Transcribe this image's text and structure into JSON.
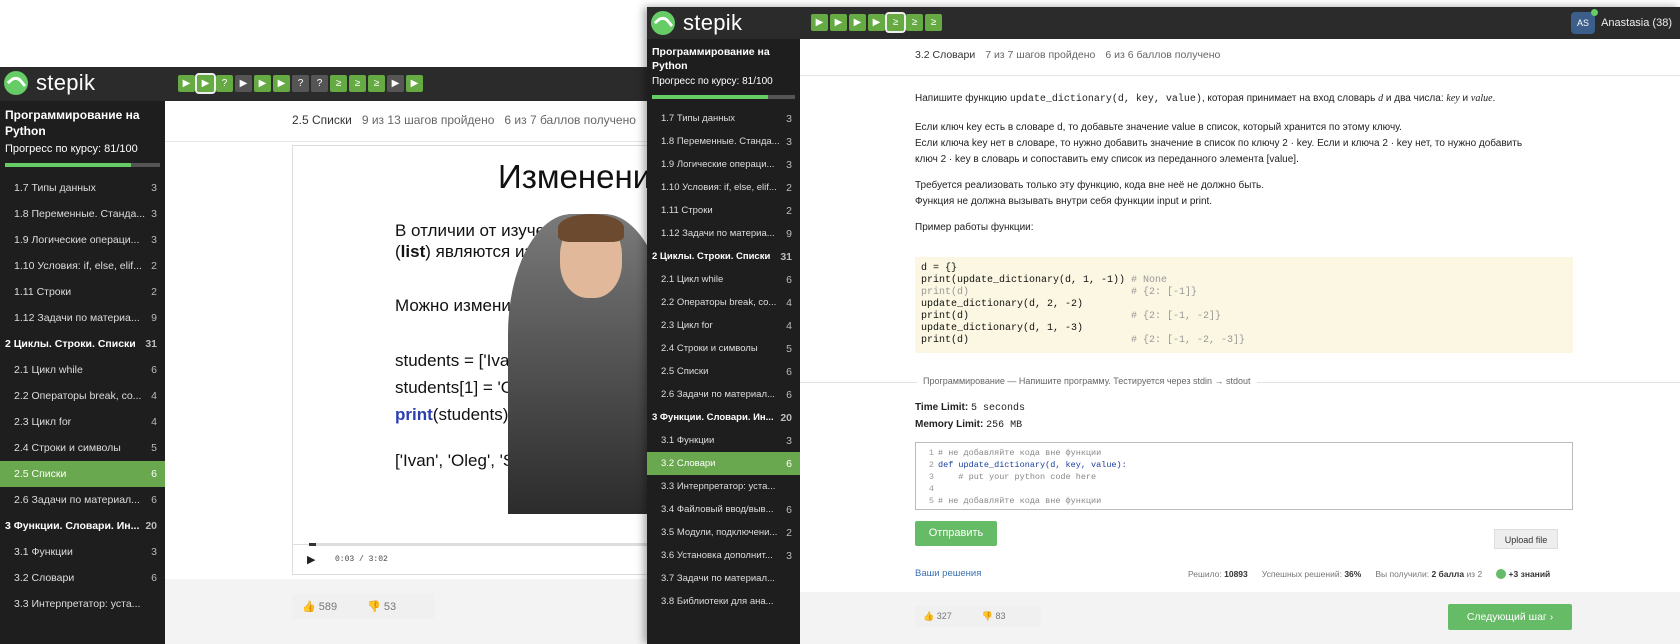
{
  "w1": {
    "logo": "stepik",
    "steps": [
      {
        "icon": "▶",
        "kind": "video"
      },
      {
        "icon": "▶",
        "kind": "video"
      },
      {
        "icon": "?",
        "kind": "quiz"
      },
      {
        "icon": "▶",
        "kind": "video"
      },
      {
        "icon": "▶",
        "kind": "video"
      },
      {
        "icon": "▶",
        "kind": "video"
      },
      {
        "icon": "?",
        "kind": "quiz"
      },
      {
        "icon": "?",
        "kind": "quiz"
      },
      {
        "icon": "≥",
        "kind": "code"
      },
      {
        "icon": "≥",
        "kind": "code"
      },
      {
        "icon": "≥",
        "kind": "code"
      },
      {
        "icon": "▶",
        "kind": "video"
      },
      {
        "icon": "▶",
        "kind": "video"
      }
    ],
    "course": {
      "title": "Программирование на Python",
      "progress_label": "Прогресс по курсу:",
      "progress_value": "81/100",
      "progress_fraction": 0.81
    },
    "items": [
      {
        "label": "1.7 Типы данных",
        "n": "3",
        "type": "item"
      },
      {
        "label": "1.8 Переменные. Станда...",
        "n": "3",
        "type": "item"
      },
      {
        "label": "1.9 Логические операци...",
        "n": "3",
        "type": "item"
      },
      {
        "label": "1.10 Условия: if, else, elif...",
        "n": "2",
        "type": "item"
      },
      {
        "label": "1.11 Строки",
        "n": "2",
        "type": "item"
      },
      {
        "label": "1.12 Задачи по материа...",
        "n": "9",
        "type": "item"
      },
      {
        "label": "2 Циклы. Строки. Списки",
        "n": "31",
        "type": "sec"
      },
      {
        "label": "2.1 Цикл while",
        "n": "6",
        "type": "item"
      },
      {
        "label": "2.2 Операторы break, co...",
        "n": "4",
        "type": "item"
      },
      {
        "label": "2.3 Цикл for",
        "n": "4",
        "type": "item"
      },
      {
        "label": "2.4 Строки и символы",
        "n": "5",
        "type": "item"
      },
      {
        "label": "2.5 Списки",
        "n": "6",
        "type": "active"
      },
      {
        "label": "2.6 Задачи по материал...",
        "n": "6",
        "type": "item"
      },
      {
        "label": "3 Функции. Словари. Ин...",
        "n": "20",
        "type": "sec"
      },
      {
        "label": "3.1 Функции",
        "n": "3",
        "type": "item"
      },
      {
        "label": "3.2 Словари",
        "n": "6",
        "type": "item"
      },
      {
        "label": "3.3 Интерпретатор: уста...",
        "n": "",
        "type": "item"
      }
    ],
    "header": {
      "lesson": "2.5 Списки",
      "steps_done": "9 из 13 шагов пройдено",
      "points": "6 из 7 баллов получено"
    },
    "slide": {
      "title": "Изменени",
      "p1a": "В отличии от изученн",
      "p1b_bold": "list",
      "p1b_rest": ") являются измен",
      "p2": "Можно изменить конкре",
      "c1": "students = ['Ivan', 'M",
      "c2": "students[1] = 'Ole",
      "c3_kw": "print",
      "c3_rest": "(students)",
      "out": "['Ivan', 'Oleg', 'S"
    },
    "player": {
      "time": "0:03 / 3:02"
    },
    "likes": "589",
    "dislikes": "53"
  },
  "w2": {
    "logo": "stepik",
    "steps": [
      {
        "icon": "▶"
      },
      {
        "icon": "▶"
      },
      {
        "icon": "▶"
      },
      {
        "icon": "▶"
      },
      {
        "icon": "≥"
      },
      {
        "icon": "≥"
      },
      {
        "icon": "≥"
      }
    ],
    "user": {
      "initials": "AS",
      "name": "Anastasia (38)"
    },
    "course": {
      "title": "Программирование на Python",
      "progress_label": "Прогресс по курсу:",
      "progress_value": "81/100",
      "progress_fraction": 0.81
    },
    "items": [
      {
        "label": "1.7 Типы данных",
        "n": "3",
        "type": "item"
      },
      {
        "label": "1.8 Переменные. Станда...",
        "n": "3",
        "type": "item"
      },
      {
        "label": "1.9 Логические операци...",
        "n": "3",
        "type": "item"
      },
      {
        "label": "1.10 Условия: if, else, elif...",
        "n": "2",
        "type": "item"
      },
      {
        "label": "1.11 Строки",
        "n": "2",
        "type": "item"
      },
      {
        "label": "1.12 Задачи по материа...",
        "n": "9",
        "type": "item"
      },
      {
        "label": "2 Циклы. Строки. Списки",
        "n": "31",
        "type": "sec"
      },
      {
        "label": "2.1 Цикл while",
        "n": "6",
        "type": "item"
      },
      {
        "label": "2.2 Операторы break, co...",
        "n": "4",
        "type": "item"
      },
      {
        "label": "2.3 Цикл for",
        "n": "4",
        "type": "item"
      },
      {
        "label": "2.4 Строки и символы",
        "n": "5",
        "type": "item"
      },
      {
        "label": "2.5 Списки",
        "n": "6",
        "type": "item"
      },
      {
        "label": "2.6 Задачи по материал...",
        "n": "6",
        "type": "item"
      },
      {
        "label": "3 Функции. Словари. Ин...",
        "n": "20",
        "type": "sec"
      },
      {
        "label": "3.1 Функции",
        "n": "3",
        "type": "item"
      },
      {
        "label": "3.2 Словари",
        "n": "6",
        "type": "active"
      },
      {
        "label": "3.3 Интерпретатор: уста...",
        "n": "",
        "type": "item"
      },
      {
        "label": "3.4 Файловый ввод/выв...",
        "n": "6",
        "type": "item"
      },
      {
        "label": "3.5 Модули, подключени...",
        "n": "2",
        "type": "item"
      },
      {
        "label": "3.6 Установка дополнит...",
        "n": "3",
        "type": "item"
      },
      {
        "label": "3.7 Задачи по материал...",
        "n": "",
        "type": "item"
      },
      {
        "label": "3.8 Библиотеки для ана...",
        "n": "",
        "type": "item"
      }
    ],
    "header": {
      "lesson": "3.2 Словари",
      "steps_done": "7 из 7 шагов пройдено",
      "points": "6 из 6 баллов получено"
    },
    "task": {
      "l1a": "Напишите функцию ",
      "l1code": "update_dictionary(d, key, value)",
      "l1b": ", которая принимает на вход словарь ",
      "l1d": "d",
      "l1c": " и два числа: ",
      "l1key": "key",
      "l1and": " и ",
      "l1val": "value",
      "l1end": ".",
      "p2l1": "Если ключ key есть в словаре d, то добавьте значение value в список, который хранится по этому ключу.",
      "p2l2": "Если ключа key нет в словаре, то нужно добавить значение в список по ключу 2 · key. Если и ключа 2 · key нет, то нужно добавить",
      "p2l3": "ключ 2 · key в словарь и сопоставить ему список из переданного элемента [value].",
      "p3l1": "Требуется реализовать только эту функцию, кода вне неё не должно быть.",
      "p3l2": "Функция не должна вызывать внутри себя функции input и print.",
      "example_label": "Пример работы функции:",
      "code": [
        {
          "code": "d = {}",
          "comment": ""
        },
        {
          "code": "print(update_dictionary(d, 1, -1))",
          "comment": "# None"
        },
        {
          "code": "print(d)",
          "comment": "# {2: [-1]}"
        },
        {
          "code": "update_dictionary(d, 2, -2)",
          "comment": ""
        },
        {
          "code": "print(d)",
          "comment": "# {2: [-1, -2]}"
        },
        {
          "code": "update_dictionary(d, 1, -3)",
          "comment": ""
        },
        {
          "code": "print(d)",
          "comment": "# {2: [-1, -2, -3]}"
        }
      ],
      "section": "Программирование — Напишите программу. Тестируется через stdin → stdout",
      "time_limit_label": "Time Limit:",
      "time_limit": "5 seconds",
      "memory_limit_label": "Memory Limit:",
      "memory_limit": "256 MB",
      "editor": [
        "# не добавляйте кода вне функции",
        "def update_dictionary(d, key, value):",
        "    # put your python code here",
        "",
        "# не добавляйте кода вне функции"
      ],
      "submit": "Отправить",
      "upload": "Upload file",
      "solutions": "Ваши решения",
      "solved_label": "Решило:",
      "solved": "10893",
      "success_label": "Успешных решений:",
      "success": "36%",
      "got_label": "Вы получили:",
      "got": "2 балла",
      "got_of": "из 2",
      "knowledge": "+3 знаний",
      "next": "Следующий шаг"
    },
    "likes": "327",
    "dislikes": "83"
  }
}
